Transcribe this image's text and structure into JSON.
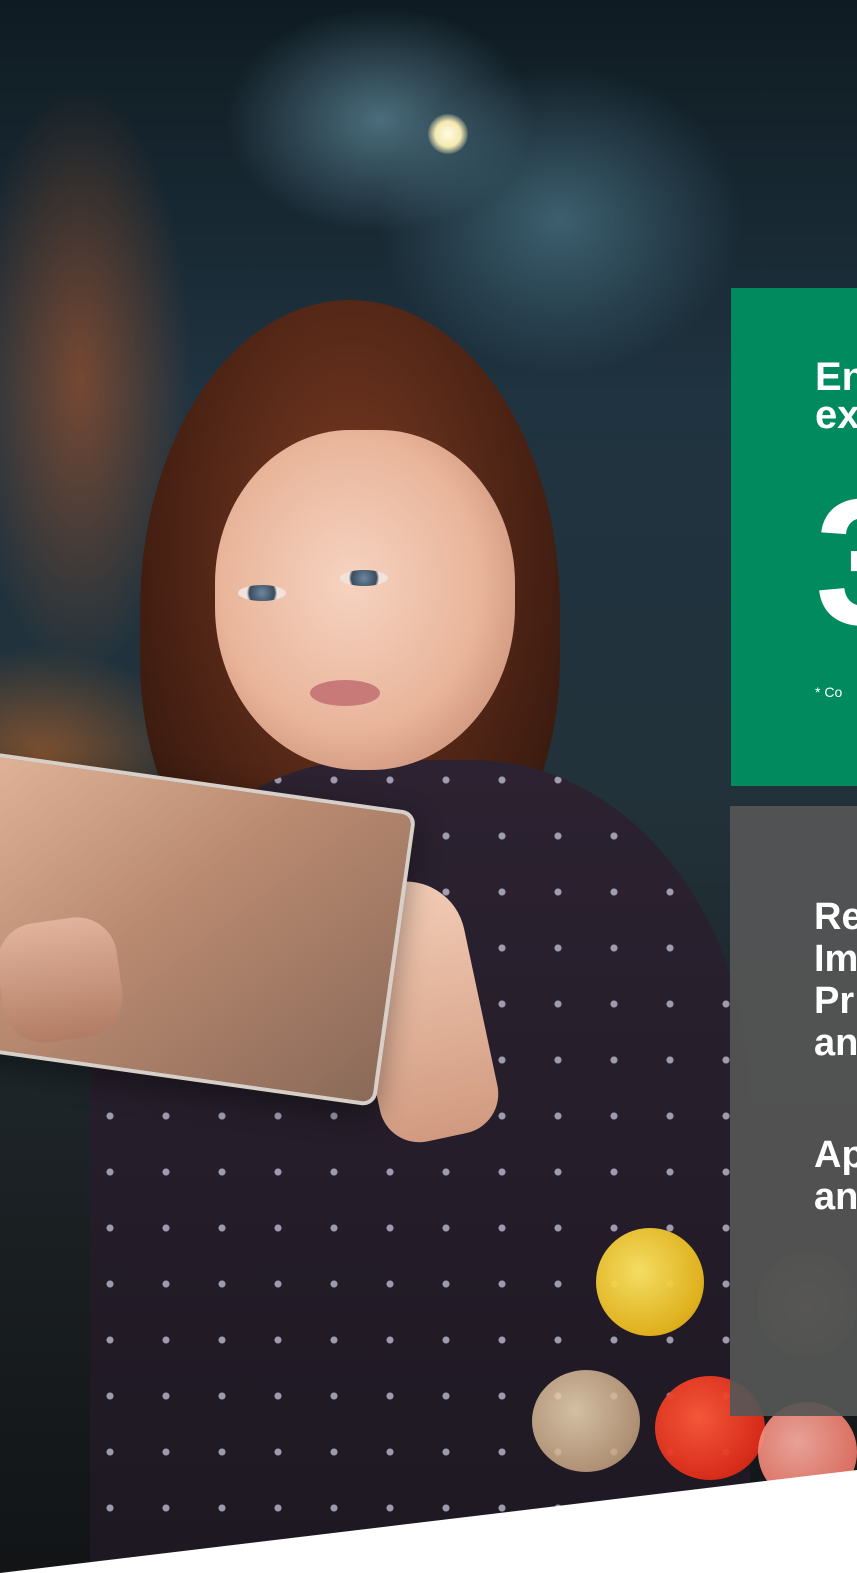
{
  "promo_green": {
    "heading": "En\nex",
    "big_number": "3",
    "footnote": "* Co"
  },
  "promo_grey": {
    "paragraph_1": "Re\nIm\nPr\nan",
    "paragraph_2": "Ap\nan"
  },
  "colors": {
    "green_card": "#008a5e",
    "grey_card": "#565656",
    "text": "#ffffff"
  }
}
